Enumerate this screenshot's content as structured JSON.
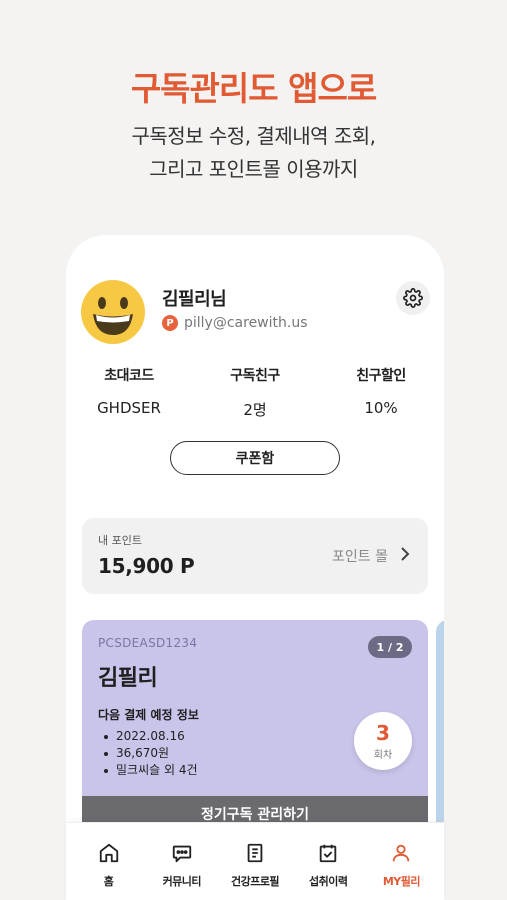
{
  "headline": "구독관리도 앱으로",
  "subline": {
    "line1": "구독정보 수정, 결제내역 조회,",
    "line2": "그리고 포인트몰 이용까지"
  },
  "profile": {
    "name": "김필리님",
    "badge_letter": "P",
    "email": "pilly@carewith.us",
    "avatar_icon": "grinning-face-icon",
    "settings_icon": "gear-icon"
  },
  "stats": [
    {
      "label": "초대코드",
      "value": "GHDSER"
    },
    {
      "label": "구독친구",
      "value": "2명"
    },
    {
      "label": "친구할인",
      "value": "10%"
    }
  ],
  "coupon_button": "쿠폰함",
  "points": {
    "label": "내 포인트",
    "value": "15,900 P",
    "mall_link": "포인트 몰"
  },
  "subscription_card": {
    "code": "PCSDEASD1234",
    "pager": "1 / 2",
    "name": "김필리",
    "next_payment_title": "다음 결제 예정 정보",
    "details": [
      "2022.08.16",
      "36,670원",
      "밀크씨슬 외 4건"
    ],
    "round_number": "3",
    "round_unit": "회차",
    "manage_button": "정기구독 관리하기"
  },
  "tabs": [
    {
      "label": "홈",
      "icon": "home-icon",
      "active": false
    },
    {
      "label": "커뮤니티",
      "icon": "chat-bubble-icon",
      "active": false
    },
    {
      "label": "건강프로필",
      "icon": "document-icon",
      "active": false
    },
    {
      "label": "섭취이력",
      "icon": "calendar-check-icon",
      "active": false
    },
    {
      "label": "MY필리",
      "icon": "person-icon",
      "active": true
    }
  ],
  "colors": {
    "accent": "#e05a33",
    "card_purple": "#c8c4ea",
    "manage_bar": "#6b6a6f",
    "background": "#f4f3f1"
  }
}
